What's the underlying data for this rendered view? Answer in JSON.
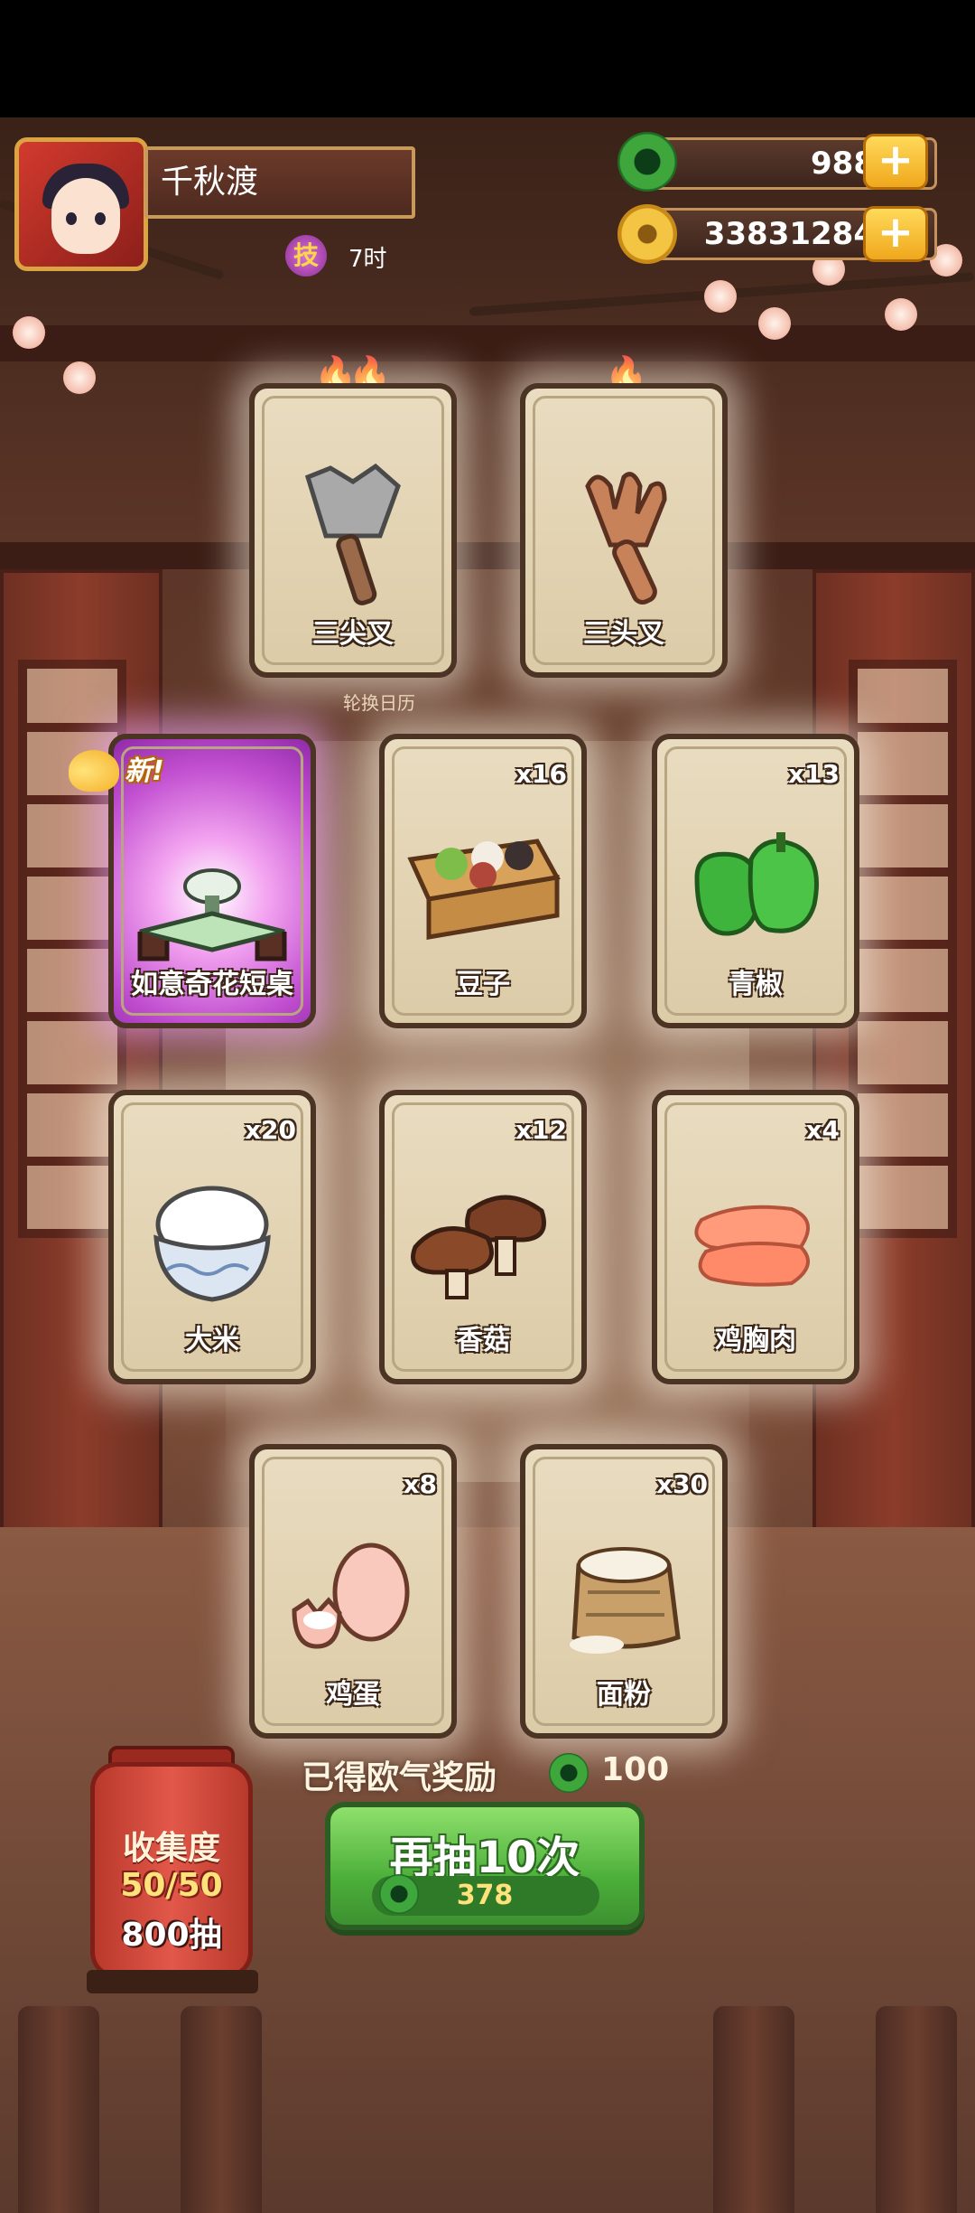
{
  "player": {
    "name": "千秋渡",
    "skill_badge": "技",
    "skill_time": "7时"
  },
  "resources": {
    "jade": "988",
    "coins": "33831284",
    "plus": "+"
  },
  "calendar_label": "轮换日历",
  "top_cards": [
    {
      "name": "三尖叉",
      "flames": 2
    },
    {
      "name": "三头叉",
      "flames": 1
    }
  ],
  "cards": [
    {
      "name": "如意奇花短桌",
      "count": "",
      "new_tag": "新!"
    },
    {
      "name": "豆子",
      "count": "x16"
    },
    {
      "name": "青椒",
      "count": "x13"
    },
    {
      "name": "大米",
      "count": "x20"
    },
    {
      "name": "香菇",
      "count": "x12"
    },
    {
      "name": "鸡胸肉",
      "count": "x4"
    },
    {
      "name": "鸡蛋",
      "count": "x8"
    },
    {
      "name": "面粉",
      "count": "x30"
    }
  ],
  "collection": {
    "title": "收集度",
    "progress": "50/50",
    "draws": "800抽"
  },
  "reward": {
    "label": "已得欧气奖励",
    "value": "100"
  },
  "draw_button": {
    "label": "再抽10次",
    "cost": "378"
  },
  "icons": [
    "jade-icon",
    "coin-icon",
    "plus-icon",
    "flame-icon",
    "butterfly-icon"
  ]
}
